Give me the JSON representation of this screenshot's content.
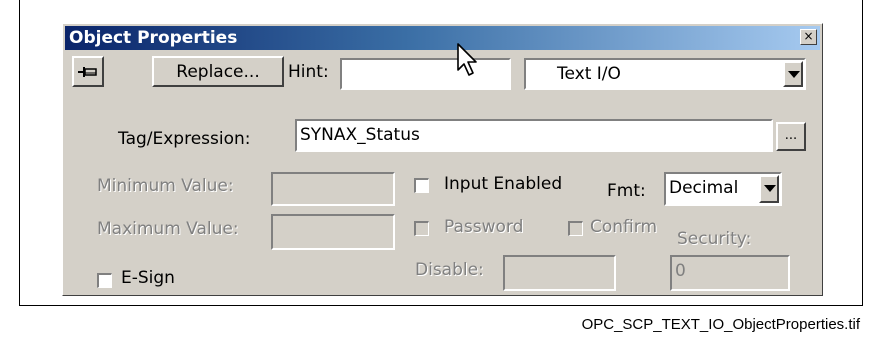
{
  "window": {
    "title": "Object Properties",
    "close_glyph": "×"
  },
  "toolbar": {
    "pin_icon": "pin-icon",
    "replace_label": "Replace...",
    "hint_label": "Hint:",
    "hint_value": "",
    "type_select_value": "Text I/O"
  },
  "tag": {
    "label": "Tag/Expression:",
    "value": "SYNAX_Status",
    "browse_label": "..."
  },
  "limits": {
    "minimum_label": "Minimum Value:",
    "minimum_value": "",
    "maximum_label": "Maximum Value:",
    "maximum_value": ""
  },
  "options": {
    "input_enabled_label": "Input Enabled",
    "input_enabled": false,
    "password_label": "Password",
    "password": false,
    "confirm_label": "Confirm",
    "confirm": false,
    "esign_label": "E-Sign",
    "esign": false
  },
  "format": {
    "label": "Fmt:",
    "value": "Decimal"
  },
  "security": {
    "label": "Security:",
    "value": "0"
  },
  "disable": {
    "label": "Disable:",
    "value": ""
  },
  "caption": "OPC_SCP_TEXT_IO_ObjectProperties.tif"
}
